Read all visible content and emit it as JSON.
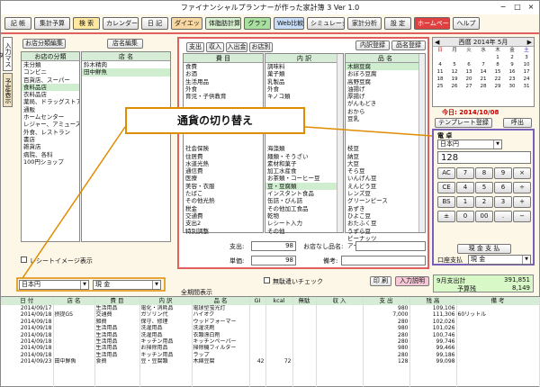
{
  "window": {
    "title": "ファイナンシャルプランナーが作った家計簿 3 Ver 1.0",
    "min": "−",
    "max": "□",
    "close": "×"
  },
  "toolbar": [
    "記 帳",
    "集計予算",
    "検 索",
    "カレンダー",
    "日 記",
    "ダイエット",
    "体脂肪計算",
    "グラフ",
    "Web比較",
    "シミュレーション",
    "家計分析",
    "設 定",
    "ホームページ",
    "ヘルプ"
  ],
  "sidetabs": [
    "入力マスタ",
    "予定表示"
  ],
  "left": {
    "btn_bunrui": "お店分類編集",
    "btn_tenmei": "店名編集",
    "hdr_bunrui": "お店の分類",
    "hdr_tenmei": "店 名",
    "bunrui": [
      "未分類",
      "コンビニ",
      "百貨店、スーパー",
      "食料品店",
      "衣料品店",
      "薬局、ドラッグストア",
      "通販",
      "ホームセンター",
      "レジャー、アミューズ",
      "外食、レストラン",
      "書店",
      "雑貨店",
      "病院、各科",
      "100円ショップ"
    ],
    "tenmei": [
      "鈴木精肉",
      "田中鮮魚"
    ],
    "checkbox": "レシートイメージ表示"
  },
  "center": {
    "tabs": [
      "支出",
      "収入",
      "入出金",
      "お店別"
    ],
    "btn_naiyou": "内訳登録",
    "btn_hinmei": "品名登録",
    "hdr_himoku": "費 目",
    "hdr_uchiwake": "内 訳",
    "hdr_hinmei": "品 名",
    "himoku": [
      "食費",
      "お酒",
      "生活用品",
      "外食",
      "育児・子供教育",
      "",
      "",
      "",
      "",
      "",
      "",
      "社会保険",
      "住居費",
      "水道光熱",
      "通信費",
      "医療",
      "美容・衣服",
      "たばこ",
      "その他光熱",
      "税金",
      "交通費",
      "支出2",
      "特別調整"
    ],
    "uchiwake": [
      "調味料",
      "菓子類",
      "乳製品",
      "外食",
      "キノコ類",
      "",
      "",
      "",
      "",
      "",
      "",
      "海藻類",
      "麺類・そうざい",
      "素材和菓子",
      "加工水産食",
      "お茶類・コーヒー豆",
      "豆・豆腐類",
      "インスタント食品",
      "缶詰・びん詰",
      "その他加工食品",
      "乾物",
      "レシート入力",
      "その他"
    ],
    "hinmei": [
      "木綿豆腐",
      "おぼろ豆腐",
      "高野豆腐",
      "油揚げ",
      "厚揚げ",
      "がんもどき",
      "おから",
      "豆乳",
      "",
      "",
      "",
      "枝豆",
      "納豆",
      "大豆",
      "そら豆",
      "いんげん豆",
      "えんどう豆",
      "レンズ豆",
      "グリーンピース",
      "あずき",
      "ひよこ豆",
      "おたふく豆",
      "うずら豆",
      "ピーナッツ",
      "アーモンド"
    ],
    "label_total": "支出:",
    "total": "98",
    "label_shop": "お店なし品名:",
    "label_price": "単価:",
    "price": "98",
    "label_note": "備考:"
  },
  "calendar": {
    "nav_prev": "◀",
    "nav_next": "▶",
    "title": "西暦 2014年 5月",
    "weekdays": [
      "日",
      "月",
      "火",
      "水",
      "木",
      "金",
      "土"
    ],
    "days": [
      "",
      "",
      "",
      "",
      "1",
      "2",
      "3",
      "4",
      "5",
      "6",
      "7",
      "8",
      "9",
      "10",
      "11",
      "12",
      "13",
      "14",
      "15",
      "16",
      "17",
      "18",
      "19",
      "20",
      "21",
      "22",
      "23",
      "24",
      "25",
      "26",
      "27",
      "28",
      "29",
      "30",
      "31"
    ],
    "today": "今日: 2014/10/08",
    "btn_template": "テンプレート登録",
    "btn_call": "呼出"
  },
  "calc": {
    "label": "電 卓",
    "currency": "日本円",
    "display": "128",
    "keys": [
      "AC",
      "7",
      "8",
      "9",
      "×",
      "CE",
      "4",
      "5",
      "6",
      "÷",
      "BS",
      "1",
      "2",
      "3",
      "+",
      "±",
      "0",
      "00",
      ".",
      "−"
    ],
    "btn_cash": "現 金 支 払",
    "label_card": "口座支払",
    "pay": "現 金"
  },
  "callout": "通貨の切り替え",
  "bottom": {
    "currency": "日本円",
    "pay": "現 金",
    "label_all": "全期間表示",
    "chk_noinput": "無駄遣いチェック",
    "btn_print": "印 刷",
    "btn_input": "入力説明",
    "month_label": "9月支出計",
    "month_value": "391,851",
    "budget_label": "予算残",
    "budget_value": "8,149",
    "columns": [
      "日 付",
      "店 名",
      "費 目",
      "内 訳",
      "品 名",
      "GI",
      "kcal",
      "無駄",
      "収 入",
      "支 出",
      "残 高",
      "備 考"
    ],
    "rows": [
      [
        "2014/09/17",
        "",
        "生活用品",
        "電化・消耗品",
        "電球型蛍光灯",
        "",
        "",
        "",
        "",
        "980",
        "109,106",
        ""
      ],
      [
        "2014/09/18",
        "摂提GS",
        "交通費",
        "ガソリン代",
        "ハイオク",
        "",
        "",
        "",
        "",
        "7,000",
        "111,306",
        "60リットル"
      ],
      [
        "2014/09/18",
        "",
        "雑費",
        "保守、修理",
        "ウッドフォーマー",
        "",
        "",
        "",
        "",
        "280",
        "102,026",
        ""
      ],
      [
        "2014/09/18",
        "",
        "生活用品",
        "洗濯用品",
        "洗濯洗剤",
        "",
        "",
        "",
        "",
        "980",
        "101,026",
        ""
      ],
      [
        "2014/09/18",
        "",
        "生活用品",
        "洗濯用品",
        "衣類漂白剤",
        "",
        "",
        "",
        "",
        "280",
        "100,746",
        ""
      ],
      [
        "2014/09/18",
        "",
        "生活用品",
        "キッチン用品",
        "キッチンペーパー",
        "",
        "",
        "",
        "",
        "280",
        "99,746",
        ""
      ],
      [
        "2014/09/18",
        "",
        "生活用品",
        "お掃除用品",
        "掃除機フィルター",
        "",
        "",
        "",
        "",
        "980",
        "99,466",
        ""
      ],
      [
        "2014/09/18",
        "",
        "生活用品",
        "キッチン用品",
        "ラップ",
        "",
        "",
        "",
        "",
        "280",
        "99,186",
        ""
      ],
      [
        "2014/09/23",
        "田中鮮魚",
        "食費",
        "豆・豆腐類",
        "木綿豆腐",
        "42",
        "72",
        "",
        "",
        "128",
        "99,098",
        ""
      ]
    ]
  },
  "colors": {
    "accent": "#e06060",
    "callout_border": "#e08c00",
    "header_green": "#d6ecd6",
    "calc_border": "#7a5fb8"
  }
}
